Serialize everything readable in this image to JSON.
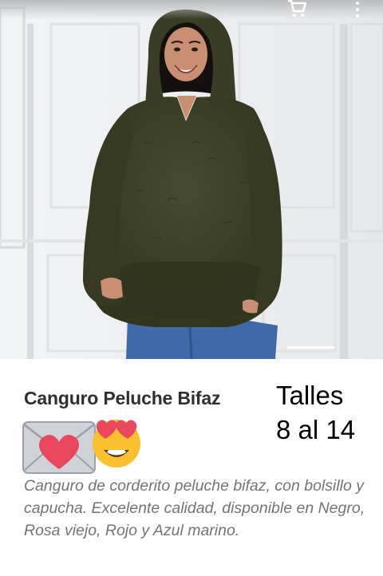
{
  "toolbar": {
    "cart_icon": "shopping-cart-icon",
    "menu_icon": "more-vertical-icon",
    "icon_color": "#ffffff"
  },
  "product": {
    "image_icon": "product-photo",
    "title": "Canguro Peluche Bifaz",
    "sizes_line1": "Talles",
    "sizes_line2": "8 al 14",
    "emojis": [
      "love-letter-emoji",
      "heart-eyes-emoji"
    ],
    "description": "Canguro de corderito peluche bifaz, con bolsillo y capucha. Excelente calidad, disponible en Negro, Rosa viejo, Rojo y Azul marino."
  },
  "colors": {
    "title": "#2f2f2f",
    "description": "#747474",
    "garment": "#3d4028",
    "heart": "#e8475d"
  }
}
